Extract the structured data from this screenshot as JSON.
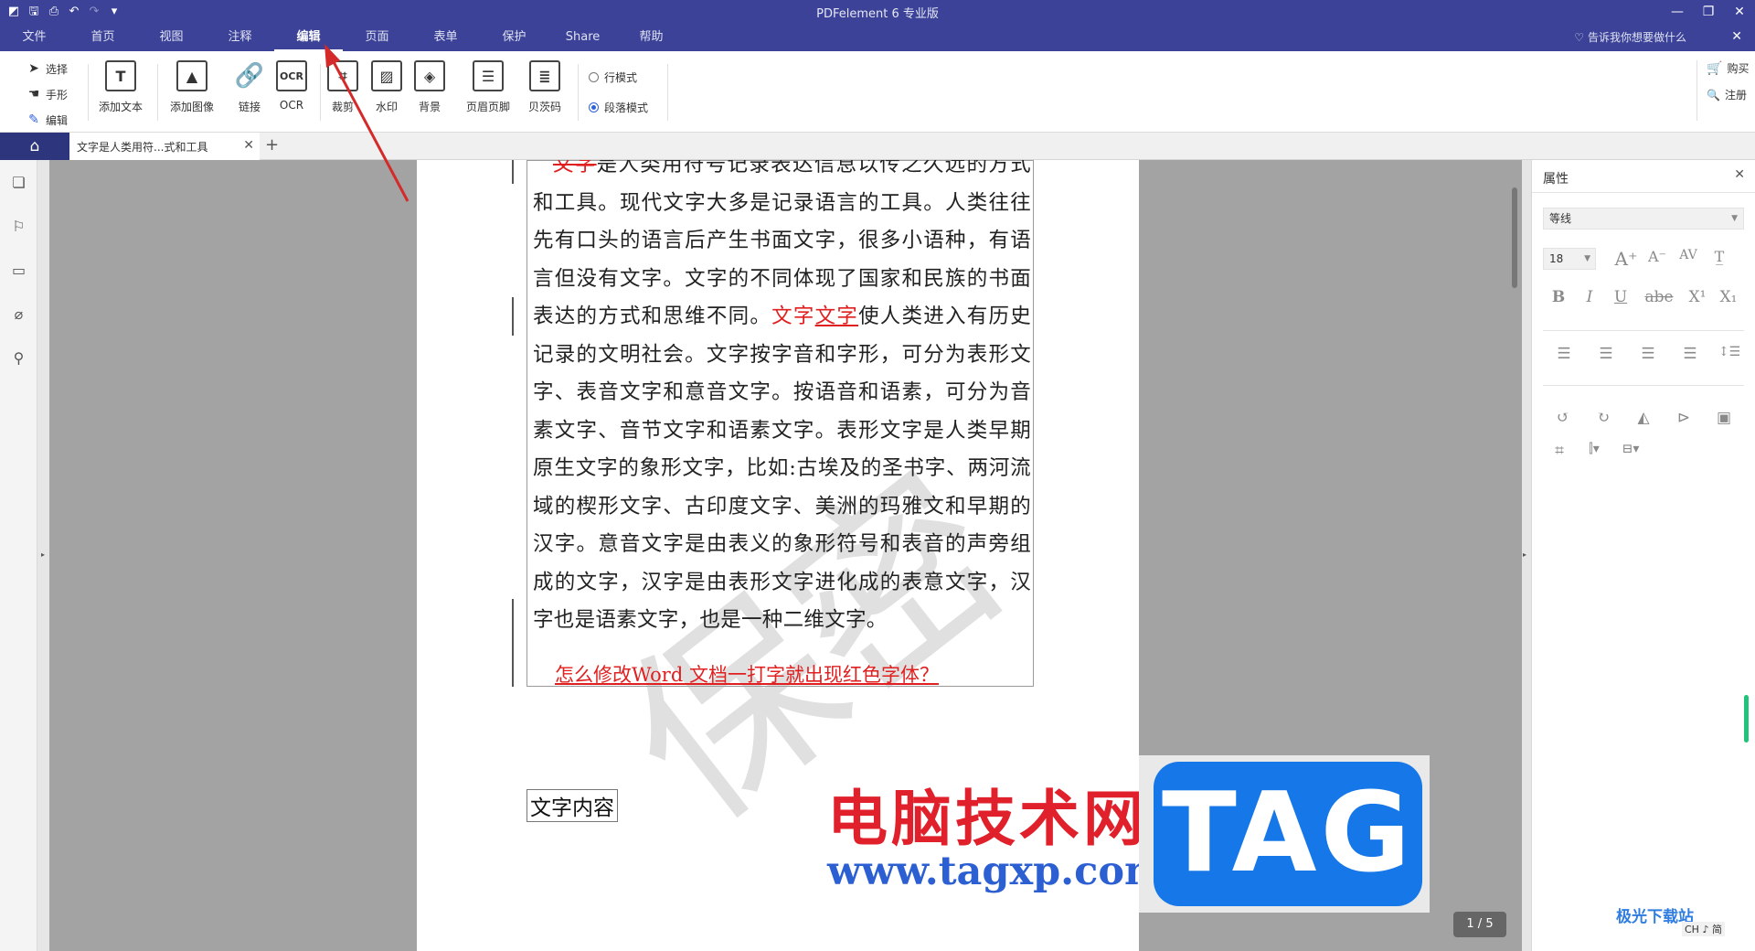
{
  "app": {
    "title": "PDFelement 6 专业版",
    "quick_access": [
      "save-icon",
      "print-icon",
      "undo-icon",
      "redo-icon",
      "customize-icon"
    ],
    "window_controls": [
      "minimize",
      "restore",
      "close"
    ]
  },
  "menu": {
    "items": [
      "文件",
      "首页",
      "视图",
      "注释",
      "编辑",
      "页面",
      "表单",
      "保护",
      "Share",
      "帮助"
    ],
    "active": "编辑",
    "tell_me": "告诉我你想要做什么"
  },
  "ribbon": {
    "modes": [
      "选择",
      "手形",
      "编辑"
    ],
    "buttons": [
      "添加文本",
      "添加图像",
      "链接",
      "OCR",
      "裁剪",
      "水印",
      "背景",
      "页眉页脚",
      "贝茨码"
    ],
    "ocr_glyph": "OCR",
    "text_glyph": "T",
    "radio_line": "行模式",
    "radio_paragraph": "段落模式",
    "buy": "购买",
    "register": "注册"
  },
  "tabs": {
    "doc_tab": "文字是人类用符...式和工具"
  },
  "document": {
    "para_strike": "文字",
    "para_1": "是人类用符号记录表达信息以传之久远的方式和工具。现代文字大多是记录语言的工具。人类往往先有口头的语言后产生书面文字，很多小语种，有语言但没有文字。文字的不同体现了国家和民族的书面表达的方式和思维不同。",
    "para_red_1": "文字",
    "para_red_2": "文字",
    "para_2": "使人类进入有历史记录的文明社会。文字按字音和字形，可分为表形文字、表音文字和意音文字。按语音和语素，可分为音素文字、音节文字和语素文字。表形文字是人类早期原生文字的象形文字，比如:古埃及的圣书字、两河流域的楔形文字、古印度文字、美洲的玛雅文和早期的汉字。意音文字是由表义的象形符号和表音的声旁组成的文字，汉字是由表形文字进化成的表意文字，汉字也是语素文字，也是一种二维文字。",
    "question": "怎么修改Word 文档一打字就出现红色字体？",
    "content_box": "文字内容",
    "watermark": "保密",
    "page_indicator": "1 / 5"
  },
  "properties": {
    "title": "属性",
    "font": "等线",
    "size": "18"
  },
  "overlay": {
    "site_cn": "电脑技术网",
    "site_url": "www.tagxp.com",
    "tag": "TAG",
    "corner_site": "极光下载站",
    "ime": "CH ♪ 简"
  }
}
